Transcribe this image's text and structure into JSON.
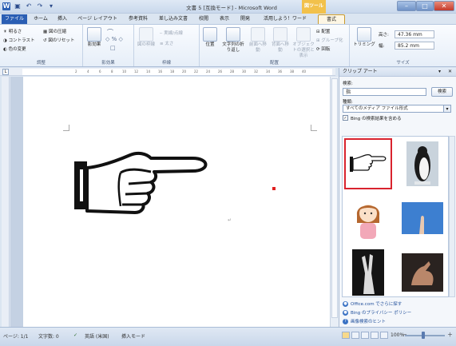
{
  "window": {
    "title": "文書 5 [互換モード] - Microsoft Word",
    "contextual_tab_group": "図ツール",
    "buttons": {
      "minimize": "–",
      "maximize": "□",
      "close": "✕"
    },
    "qat_icons": [
      "word-logo-icon",
      "save-icon",
      "undo-icon",
      "redo-icon",
      "customize-qat-icon"
    ]
  },
  "tabs": [
    "ファイル",
    "ホーム",
    "挿入",
    "ページ レイアウト",
    "参考資料",
    "差し込み文書",
    "校閲",
    "表示",
    "開発",
    "活用しよう！ワード",
    "書式"
  ],
  "ribbon": {
    "adjust": {
      "label": "調整",
      "items": [
        "明るさ",
        "コントラスト",
        "色の変更",
        "図の圧縮",
        "図のリセット"
      ]
    },
    "shadow": {
      "label": "影効果",
      "big_button": "影効果"
    },
    "border": {
      "label": "枠線",
      "items": [
        "図の枠線",
        "実線/点線",
        "太さ"
      ]
    },
    "arrange": {
      "label": "配置",
      "items": [
        "位置",
        "文字列の折り返し",
        "前面へ移動",
        "背面へ移動",
        "オブジェクトの選択と表示",
        "配置",
        "グループ化",
        "回転"
      ]
    },
    "size": {
      "label": "サイズ",
      "trim": "トリミング",
      "height_label": "高さ:",
      "height": "47.36 mm",
      "width_label": "幅:",
      "width": "85.2 mm"
    }
  },
  "ruler_ticks": [
    "2",
    "4",
    "6",
    "8",
    "10",
    "12",
    "14",
    "16",
    "18",
    "20",
    "22",
    "24",
    "26",
    "28",
    "30",
    "32",
    "34",
    "36",
    "38",
    "40"
  ],
  "clip_art": {
    "title": "クリップ アート",
    "search_label": "検索:",
    "search_value": "指",
    "search_button": "検索",
    "type_label": "種類:",
    "type_value": "すべてのメディア ファイル形式",
    "bing_checkbox": "Bing の検索結果を含める",
    "bing_checked": true,
    "results": [
      "pointing-hand-clipart",
      "penguin-photo",
      "girl-thinking-clipart",
      "finger-sky-photo",
      "foot-xray-photo",
      "hand-photo"
    ],
    "links": [
      "Office.com でさらに探す",
      "Bing のプライバシー ポリシー",
      "画像検索のヒント"
    ]
  },
  "status": {
    "page": "ページ: 1/1",
    "words": "文字数: 0",
    "language": "英語 (米国)",
    "mode": "挿入モード",
    "zoom": "100%",
    "zoom_minus": "－",
    "zoom_plus": "＋"
  }
}
